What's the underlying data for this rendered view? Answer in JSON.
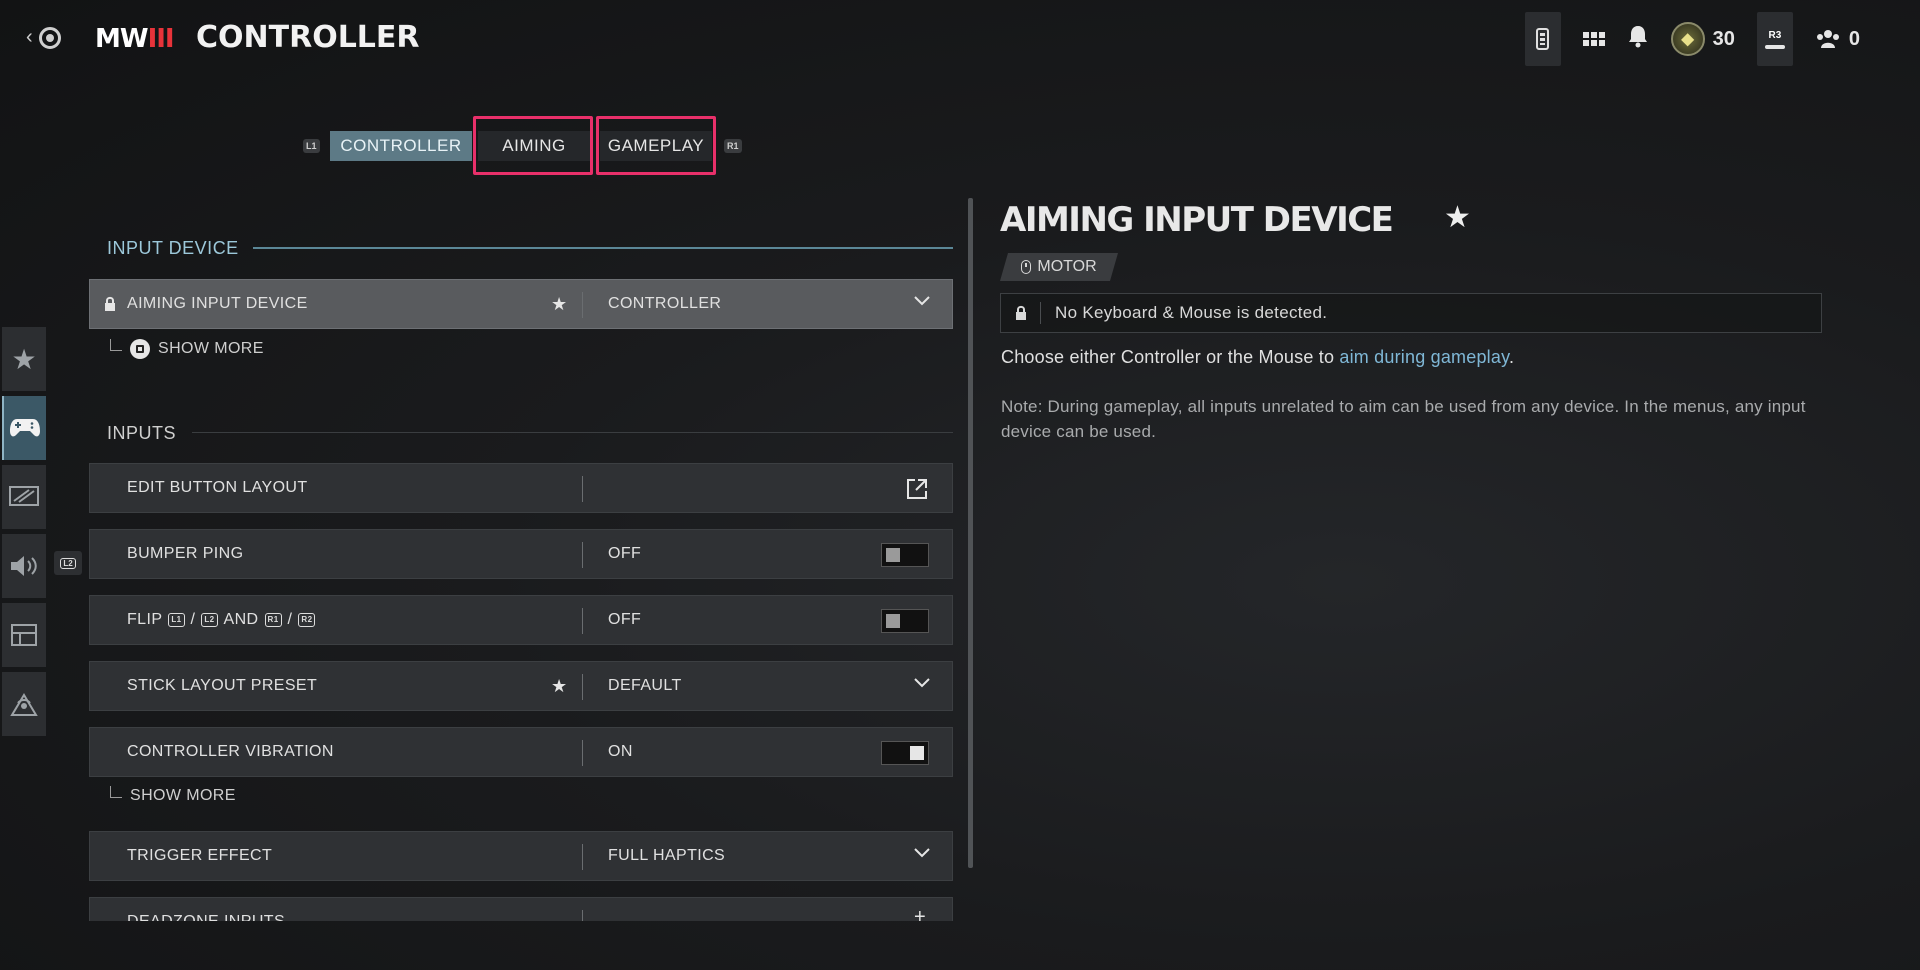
{
  "header": {
    "back_glyph": "‹",
    "logo_text": "MW",
    "logo_numeral": "III",
    "title": "CONTROLLER",
    "rank_level": "30",
    "r3_label": "R3",
    "party_count": "0",
    "icons": [
      "battery-icon",
      "apps-grid-icon",
      "bell-icon",
      "rank-emblem-icon",
      "r3-button-icon",
      "party-icon"
    ]
  },
  "tabs": {
    "l1_hint": "L1",
    "r1_hint": "R1",
    "items": [
      {
        "label": "CONTROLLER",
        "active": true
      },
      {
        "label": "AIMING",
        "active": false
      },
      {
        "label": "GAMEPLAY",
        "active": false
      }
    ],
    "highlight_color": "#e8306a"
  },
  "sidebar": {
    "items": [
      "favorites-star-icon",
      "gamepad-icon",
      "display-icon",
      "audio-speaker-icon",
      "interface-icon",
      "network-icon"
    ],
    "active_index": 1,
    "l2_hint": "L2"
  },
  "sections": {
    "input_device": "INPUT DEVICE",
    "inputs": "INPUTS"
  },
  "rows": {
    "aiming_input_device": {
      "label": "AIMING INPUT DEVICE",
      "value": "CONTROLLER"
    },
    "show_more_1": "SHOW MORE",
    "edit_button_layout": {
      "label": "EDIT BUTTON LAYOUT"
    },
    "bumper_ping": {
      "label": "BUMPER PING",
      "value": "OFF"
    },
    "flip": {
      "label_pre": "FLIP",
      "b1": "L1",
      "sep1": "/",
      "b2": "L2",
      "and": "AND",
      "b3": "R1",
      "sep2": "/",
      "b4": "R2",
      "value": "OFF"
    },
    "stick_layout_preset": {
      "label": "STICK LAYOUT PRESET",
      "value": "DEFAULT"
    },
    "controller_vibration": {
      "label": "CONTROLLER VIBRATION",
      "value": "ON"
    },
    "show_more_2": "SHOW MORE",
    "trigger_effect": {
      "label": "TRIGGER EFFECT",
      "value": "FULL HAPTICS"
    },
    "deadzone_inputs": {
      "label": "DEADZONE INPUTS"
    }
  },
  "detail": {
    "title": "AIMING INPUT DEVICE",
    "tag": "MOTOR",
    "lock_message": "No Keyboard & Mouse is detected.",
    "description_pre": "Choose either Controller or the Mouse to ",
    "description_link": "aim during gameplay",
    "description_post": ".",
    "note": "Note: During gameplay, all inputs unrelated to aim can be used from any device. In the menus, any input device can be used."
  },
  "colors": {
    "accent": "#5d7a86",
    "section_accent": "#9cc8da",
    "link": "#7fb7d6",
    "logo_red": "#e8333a"
  }
}
